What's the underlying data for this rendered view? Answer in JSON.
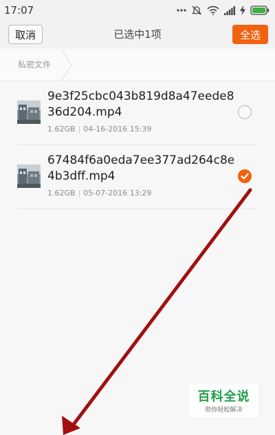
{
  "status_bar": {
    "time": "17:07",
    "icons": [
      "more-dots-icon",
      "mute-icon",
      "wifi-icon",
      "signal-icon",
      "charging-icon",
      "battery-icon"
    ]
  },
  "header": {
    "cancel_label": "取消",
    "title": "已选中1项",
    "select_all_label": "全选"
  },
  "breadcrumb": {
    "items": [
      "私密文件"
    ]
  },
  "files": [
    {
      "name": "9e3f25cbc043b819d8a47eede836d204.mp4",
      "size": "1.62GB",
      "date": "04-16-2016 15:39",
      "selected": false
    },
    {
      "name": "67484f6a0eda7ee377ad264c8e4b3dff.mp4",
      "size": "1.62GB",
      "date": "05-07-2016 13:29",
      "selected": true
    }
  ],
  "watermark": {
    "title": "百科全说",
    "subtitle": "助你轻松解决"
  },
  "colors": {
    "accent": "#f0620f",
    "watermark_green": "#1e9e4a",
    "arrow": "#a30f0f"
  }
}
